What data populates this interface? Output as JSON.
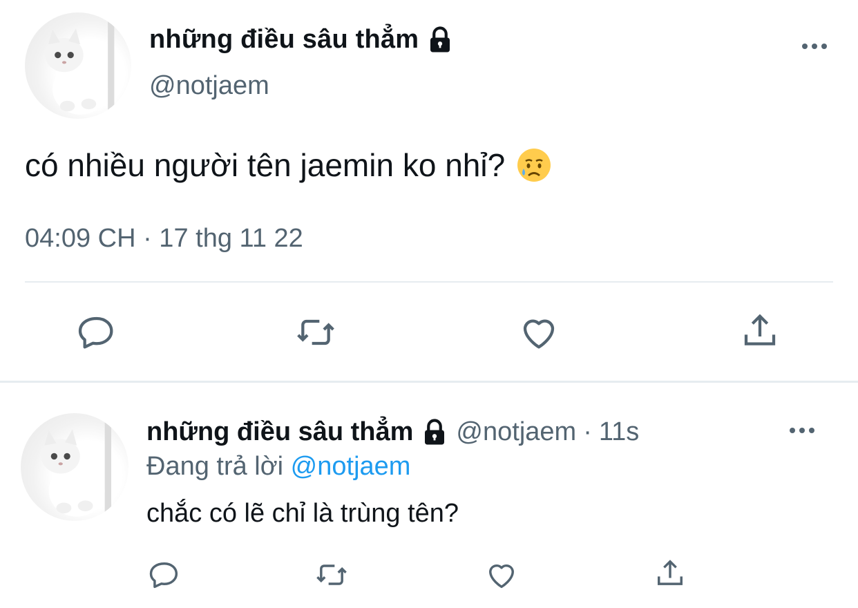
{
  "main_tweet": {
    "display_name": "những điều sâu thẳm",
    "handle": "@notjaem",
    "text": "có nhiều người tên jaemin ko nhỉ?",
    "emoji_icon": "sad-relieved-face-emoji",
    "timestamp": "04:09 CH · 17 thg 11 22",
    "actions": [
      "reply-icon",
      "retweet-icon",
      "like-icon",
      "share-icon"
    ]
  },
  "reply_tweet": {
    "display_name": "những điều sâu thẳm",
    "handle": "@notjaem",
    "separator": "·",
    "time": "11s",
    "replying_prefix": "Đang trả lời",
    "replying_to": "@notjaem",
    "text": "chắc có lẽ chỉ là trùng tên?",
    "actions": [
      "reply-icon",
      "retweet-icon",
      "like-icon",
      "share-icon"
    ]
  },
  "colors": {
    "text": "#0f1419",
    "secondary": "#536471",
    "link": "#1d9bf0",
    "divider": "#e6ecf0"
  }
}
